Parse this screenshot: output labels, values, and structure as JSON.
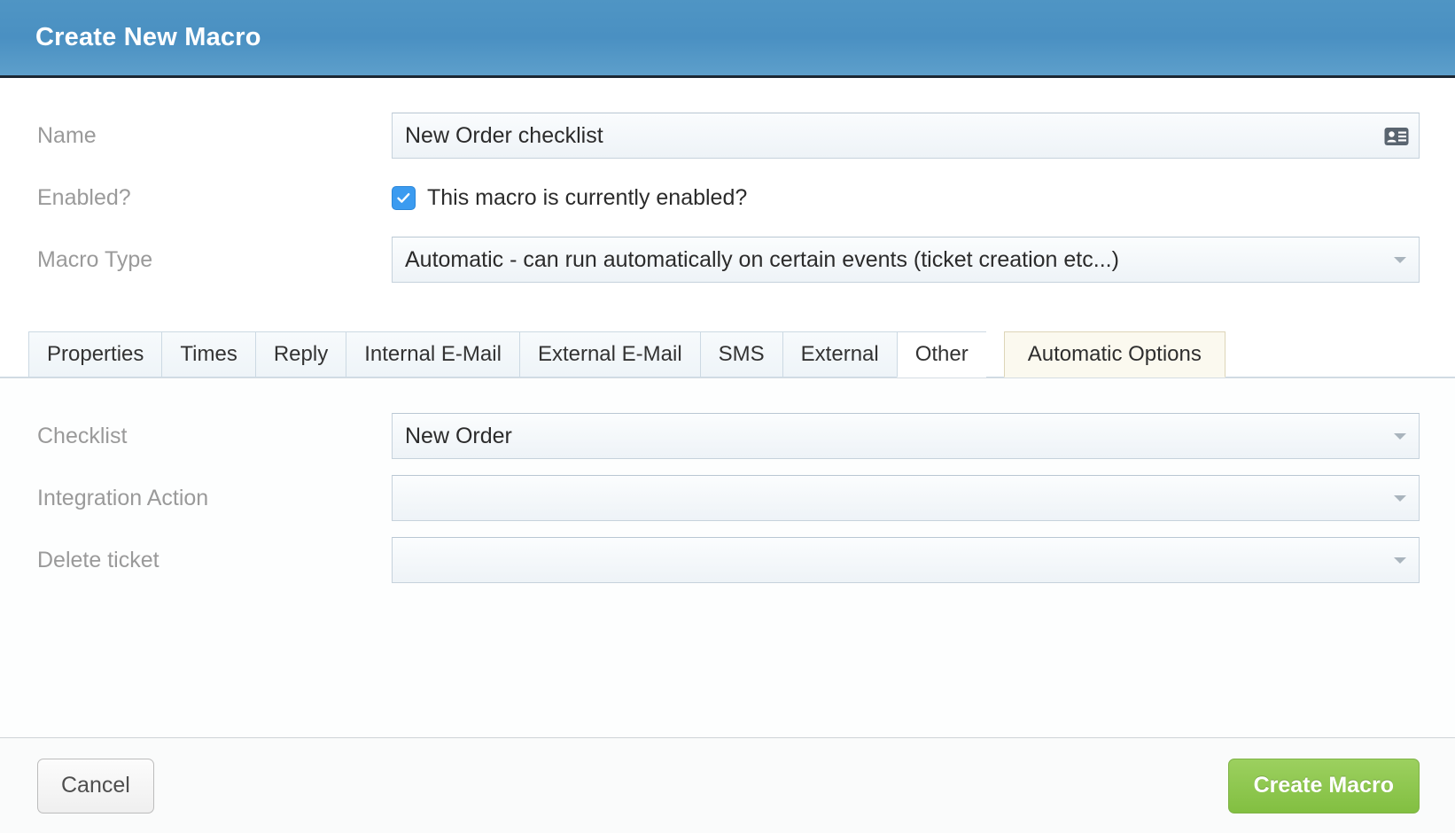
{
  "window": {
    "title": "Create New Macro"
  },
  "colors": {
    "header_blue": "#4a90c2",
    "checkbox_blue": "#3b9bf0",
    "primary_green": "#8cc751",
    "active_tab_cream": "#fbf9ef"
  },
  "form": {
    "name": {
      "label": "Name",
      "value": "New Order checklist",
      "placeholder": "",
      "icon": "vcard-icon"
    },
    "enabled": {
      "label": "Enabled?",
      "checkbox_label": "This macro is currently enabled?",
      "checked": true
    },
    "macro_type": {
      "label": "Macro Type",
      "value": "Automatic - can run automatically on certain events (ticket creation etc...)"
    }
  },
  "tabs": [
    {
      "label": "Properties",
      "state": "normal"
    },
    {
      "label": "Times",
      "state": "normal"
    },
    {
      "label": "Reply",
      "state": "normal"
    },
    {
      "label": "Internal E-Mail",
      "state": "normal"
    },
    {
      "label": "External E-Mail",
      "state": "normal"
    },
    {
      "label": "SMS",
      "state": "normal"
    },
    {
      "label": "External",
      "state": "normal"
    },
    {
      "label": "Other",
      "state": "white"
    },
    {
      "label": "Automatic Options",
      "state": "active"
    }
  ],
  "panel": {
    "fields": [
      {
        "label": "Checklist",
        "value": "New Order"
      },
      {
        "label": "Integration Action",
        "value": ""
      },
      {
        "label": "Delete ticket",
        "value": ""
      }
    ]
  },
  "footer": {
    "cancel_label": "Cancel",
    "create_label": "Create Macro"
  }
}
